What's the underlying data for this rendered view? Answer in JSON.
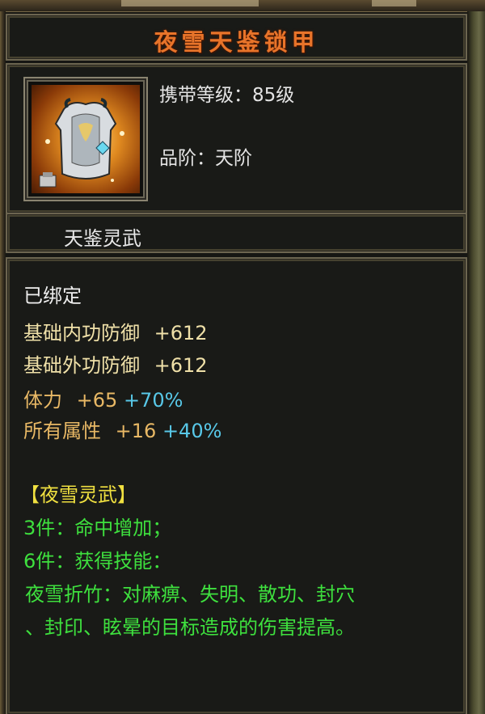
{
  "item": {
    "name": "夜雪天鉴锁甲",
    "icon": "armor-chestplate-icon",
    "carry_level_label": "携带等级：",
    "carry_level_value": "85级",
    "grade_label": "品阶：",
    "grade_value": "天阶",
    "set_name": "天鉴灵武"
  },
  "status": {
    "bound": "已绑定"
  },
  "base_stats": [
    {
      "label": "基础内功防御",
      "value": "+612"
    },
    {
      "label": "基础外功防御",
      "value": "+612"
    }
  ],
  "bonus_stats": [
    {
      "label": "体力",
      "value": "+65",
      "percent": "+70%"
    },
    {
      "label": "所有属性",
      "value": "+16",
      "percent": "+40%"
    }
  ],
  "set_bonus": {
    "title": "【夜雪灵武】",
    "piece3": "3件：命中增加；",
    "piece6": "6件：获得技能：",
    "skill_line1": "夜雪折竹：对麻痹、失明、散功、封穴",
    "skill_line2": "、封印、眩晕的目标造成的伤害提高。"
  },
  "colors": {
    "title": "#e8742a",
    "base_stat": "#efe0a8",
    "bonus_stat": "#e8b865",
    "percent": "#58c8e8",
    "set_title": "#f0e040",
    "set_text": "#3ee03e"
  }
}
